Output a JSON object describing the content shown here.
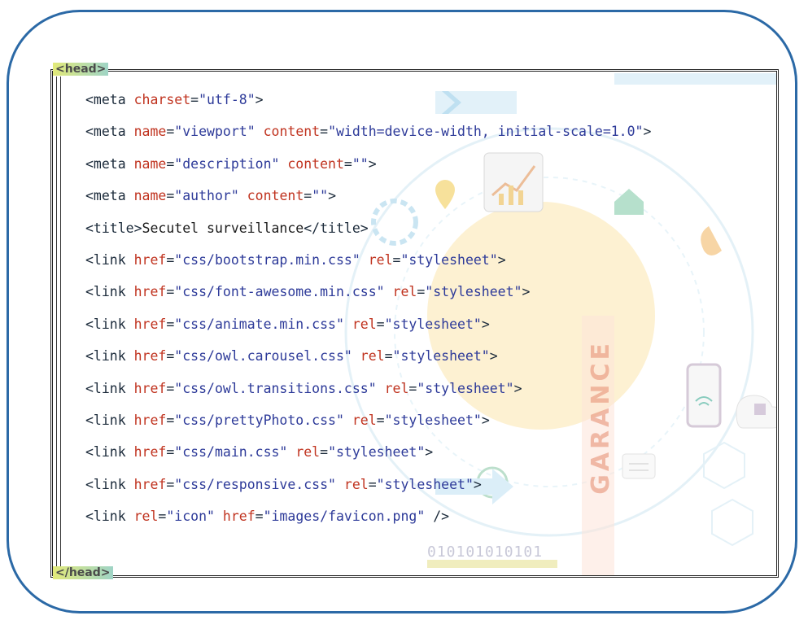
{
  "code": {
    "open_tag": "<head>",
    "close_tag": "</head>",
    "lines": [
      [
        {
          "k": "t",
          "s": "<meta "
        },
        {
          "k": "a",
          "s": "charset"
        },
        {
          "k": "t",
          "s": "="
        },
        {
          "k": "v",
          "s": "\"utf-8\""
        },
        {
          "k": "t",
          "s": ">"
        }
      ],
      [
        {
          "k": "t",
          "s": "<meta "
        },
        {
          "k": "a",
          "s": "name"
        },
        {
          "k": "t",
          "s": "="
        },
        {
          "k": "v",
          "s": "\"viewport\""
        },
        {
          "k": "t",
          "s": " "
        },
        {
          "k": "a",
          "s": "content"
        },
        {
          "k": "t",
          "s": "="
        },
        {
          "k": "v",
          "s": "\"width=device-width, initial-scale=1.0\""
        },
        {
          "k": "t",
          "s": ">"
        }
      ],
      [
        {
          "k": "t",
          "s": "<meta "
        },
        {
          "k": "a",
          "s": "name"
        },
        {
          "k": "t",
          "s": "="
        },
        {
          "k": "v",
          "s": "\"description\""
        },
        {
          "k": "t",
          "s": " "
        },
        {
          "k": "a",
          "s": "content"
        },
        {
          "k": "t",
          "s": "="
        },
        {
          "k": "v",
          "s": "\"\""
        },
        {
          "k": "t",
          "s": ">"
        }
      ],
      [
        {
          "k": "t",
          "s": "<meta "
        },
        {
          "k": "a",
          "s": "name"
        },
        {
          "k": "t",
          "s": "="
        },
        {
          "k": "v",
          "s": "\"author\""
        },
        {
          "k": "t",
          "s": " "
        },
        {
          "k": "a",
          "s": "content"
        },
        {
          "k": "t",
          "s": "="
        },
        {
          "k": "v",
          "s": "\"\""
        },
        {
          "k": "t",
          "s": ">"
        }
      ],
      [
        {
          "k": "t",
          "s": "<title>"
        },
        {
          "k": "c",
          "s": "Secutel surveillance"
        },
        {
          "k": "t",
          "s": "</title>"
        }
      ],
      [
        {
          "k": "t",
          "s": "<link "
        },
        {
          "k": "a",
          "s": "href"
        },
        {
          "k": "t",
          "s": "="
        },
        {
          "k": "v",
          "s": "\"css/bootstrap.min.css\""
        },
        {
          "k": "t",
          "s": " "
        },
        {
          "k": "a",
          "s": "rel"
        },
        {
          "k": "t",
          "s": "="
        },
        {
          "k": "v",
          "s": "\"stylesheet\""
        },
        {
          "k": "t",
          "s": ">"
        }
      ],
      [
        {
          "k": "t",
          "s": "<link "
        },
        {
          "k": "a",
          "s": "href"
        },
        {
          "k": "t",
          "s": "="
        },
        {
          "k": "v",
          "s": "\"css/font-awesome.min.css\""
        },
        {
          "k": "t",
          "s": " "
        },
        {
          "k": "a",
          "s": "rel"
        },
        {
          "k": "t",
          "s": "="
        },
        {
          "k": "v",
          "s": "\"stylesheet\""
        },
        {
          "k": "t",
          "s": ">"
        }
      ],
      [
        {
          "k": "t",
          "s": "<link "
        },
        {
          "k": "a",
          "s": "href"
        },
        {
          "k": "t",
          "s": "="
        },
        {
          "k": "v",
          "s": "\"css/animate.min.css\""
        },
        {
          "k": "t",
          "s": " "
        },
        {
          "k": "a",
          "s": "rel"
        },
        {
          "k": "t",
          "s": "="
        },
        {
          "k": "v",
          "s": "\"stylesheet\""
        },
        {
          "k": "t",
          "s": ">"
        }
      ],
      [
        {
          "k": "t",
          "s": "<link "
        },
        {
          "k": "a",
          "s": "href"
        },
        {
          "k": "t",
          "s": "="
        },
        {
          "k": "v",
          "s": "\"css/owl.carousel.css\""
        },
        {
          "k": "t",
          "s": " "
        },
        {
          "k": "a",
          "s": "rel"
        },
        {
          "k": "t",
          "s": "="
        },
        {
          "k": "v",
          "s": "\"stylesheet\""
        },
        {
          "k": "t",
          "s": ">"
        }
      ],
      [
        {
          "k": "t",
          "s": "<link "
        },
        {
          "k": "a",
          "s": "href"
        },
        {
          "k": "t",
          "s": "="
        },
        {
          "k": "v",
          "s": "\"css/owl.transitions.css\""
        },
        {
          "k": "t",
          "s": " "
        },
        {
          "k": "a",
          "s": "rel"
        },
        {
          "k": "t",
          "s": "="
        },
        {
          "k": "v",
          "s": "\"stylesheet\""
        },
        {
          "k": "t",
          "s": ">"
        }
      ],
      [
        {
          "k": "t",
          "s": "<link "
        },
        {
          "k": "a",
          "s": "href"
        },
        {
          "k": "t",
          "s": "="
        },
        {
          "k": "v",
          "s": "\"css/prettyPhoto.css\""
        },
        {
          "k": "t",
          "s": " "
        },
        {
          "k": "a",
          "s": "rel"
        },
        {
          "k": "t",
          "s": "="
        },
        {
          "k": "v",
          "s": "\"stylesheet\""
        },
        {
          "k": "t",
          "s": ">"
        }
      ],
      [
        {
          "k": "t",
          "s": "<link "
        },
        {
          "k": "a",
          "s": "href"
        },
        {
          "k": "t",
          "s": "="
        },
        {
          "k": "v",
          "s": "\"css/main.css\""
        },
        {
          "k": "t",
          "s": " "
        },
        {
          "k": "a",
          "s": "rel"
        },
        {
          "k": "t",
          "s": "="
        },
        {
          "k": "v",
          "s": "\"stylesheet\""
        },
        {
          "k": "t",
          "s": ">"
        }
      ],
      [
        {
          "k": "t",
          "s": "<link "
        },
        {
          "k": "a",
          "s": "href"
        },
        {
          "k": "t",
          "s": "="
        },
        {
          "k": "v",
          "s": "\"css/responsive.css\""
        },
        {
          "k": "t",
          "s": " "
        },
        {
          "k": "a",
          "s": "rel"
        },
        {
          "k": "t",
          "s": "="
        },
        {
          "k": "v",
          "s": "\"stylesheet\""
        },
        {
          "k": "t",
          "s": ">"
        }
      ],
      [
        {
          "k": "t",
          "s": "<link "
        },
        {
          "k": "a",
          "s": "rel"
        },
        {
          "k": "t",
          "s": "="
        },
        {
          "k": "v",
          "s": "\"icon\""
        },
        {
          "k": "t",
          "s": " "
        },
        {
          "k": "a",
          "s": "href"
        },
        {
          "k": "t",
          "s": "="
        },
        {
          "k": "v",
          "s": "\"images/favicon.png\""
        },
        {
          "k": "t",
          "s": " />"
        }
      ]
    ]
  },
  "background": {
    "watermark_text": "GARANCE",
    "binary_text": "010101010101"
  },
  "colors": {
    "frame": "#2b69a6",
    "tag": "#1b2a3a",
    "attribute": "#c0331f",
    "value": "#2d3a99"
  }
}
